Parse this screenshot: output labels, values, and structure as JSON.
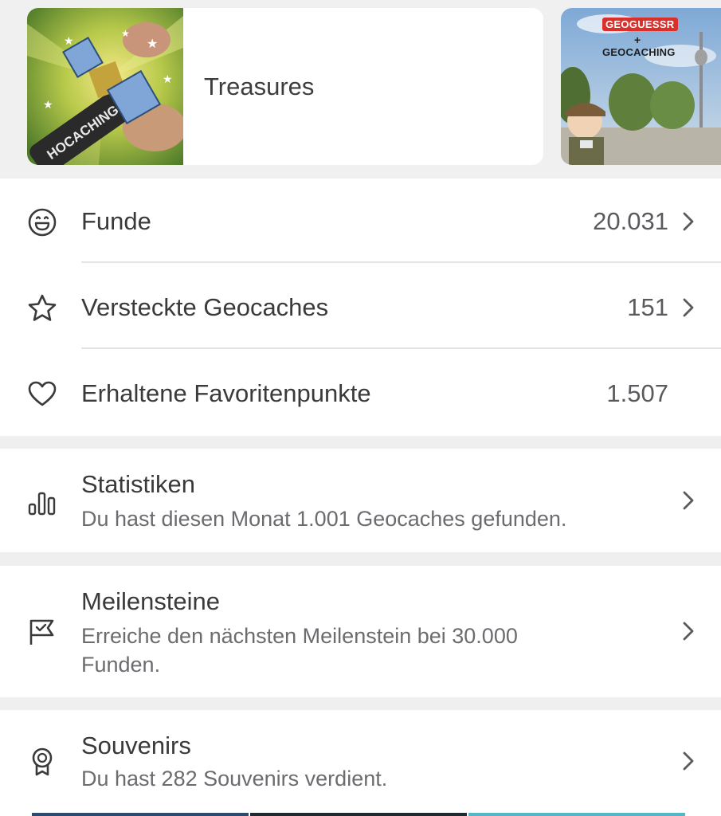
{
  "carousel": {
    "cards": [
      {
        "title": "Treasures",
        "image": "geocaching-treasures-illustration"
      },
      {
        "badge": "GEOGUESSR",
        "plus": "+",
        "brand": "GEOCACHING",
        "image": "geoguessr-geocaching-promo"
      }
    ]
  },
  "stats": {
    "rows": [
      {
        "icon": "smile-icon",
        "label": "Funde",
        "value": "20.031",
        "chevron": true
      },
      {
        "icon": "star-icon",
        "label": "Versteckte Geocaches",
        "value": "151",
        "chevron": true
      },
      {
        "icon": "heart-icon",
        "label": "Erhaltene Favoritenpunkte",
        "value": "1.507",
        "chevron": false
      }
    ]
  },
  "cards": {
    "statistics": {
      "icon": "bar-chart-icon",
      "title": "Statistiken",
      "subtitle": "Du hast diesen Monat 1.001 Geocaches gefunden."
    },
    "milestones": {
      "icon": "flag-icon",
      "title": "Meilensteine",
      "subtitle": "Erreiche den nächsten Meilenstein bei 30.000 Funden."
    },
    "souvenirs": {
      "icon": "award-icon",
      "title": "Souvenirs",
      "subtitle": "Du hast 282 Souvenirs verdient."
    }
  }
}
